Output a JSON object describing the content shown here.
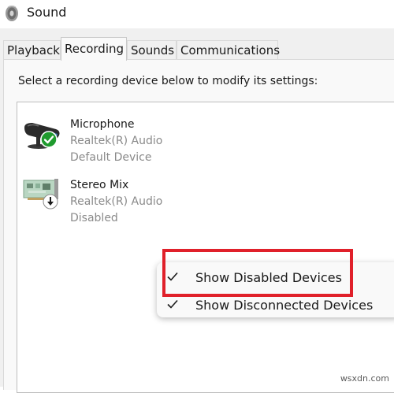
{
  "window": {
    "title": "Sound",
    "icon": "speaker-icon"
  },
  "tabs": [
    {
      "label": "Playback",
      "active": false
    },
    {
      "label": "Recording",
      "active": true
    },
    {
      "label": "Sounds",
      "active": false
    },
    {
      "label": "Communications",
      "active": false
    }
  ],
  "panel": {
    "instruction": "Select a recording device below to modify its settings:"
  },
  "devices": [
    {
      "name": "Microphone",
      "driver": "Realtek(R) Audio",
      "status": "Default Device",
      "icon": "microphone-icon",
      "badge": "default-check-badge",
      "badge_color": "#1f9a2e"
    },
    {
      "name": "Stereo Mix",
      "driver": "Realtek(R) Audio",
      "status": "Disabled",
      "icon": "sound-card-icon",
      "badge": "disabled-arrow-badge"
    }
  ],
  "context_menu": {
    "items": [
      {
        "label": "Show Disabled Devices",
        "checked": true
      },
      {
        "label": "Show Disconnected Devices",
        "checked": true
      }
    ]
  },
  "annotation": {
    "highlight_color": "#e0202a"
  },
  "watermark": "wsxdn.com"
}
